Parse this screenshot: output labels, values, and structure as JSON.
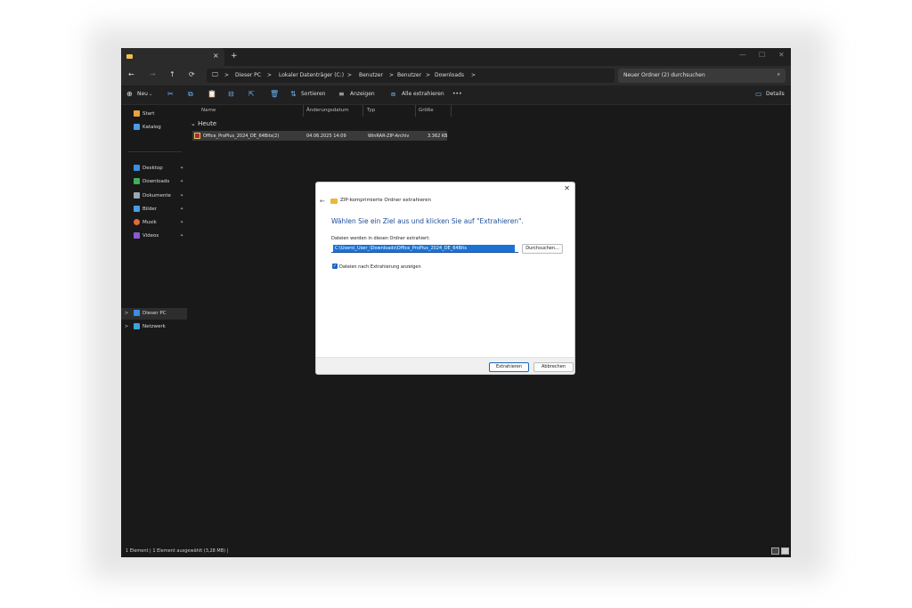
{
  "window": {
    "tab_close": "×",
    "tab_new": "+",
    "controls": {
      "minimize": "—",
      "maximize": "☐",
      "close": "✕"
    }
  },
  "nav": {
    "back": "←",
    "forward": "→",
    "up": "↑",
    "refresh": "⟳",
    "breadcrumb": [
      "Dieser PC",
      "Lokaler Datenträger (C:)",
      "Benutzer",
      "Benutzer",
      "Downloads"
    ],
    "separator": ">",
    "search_placeholder": "Neuer Ordner (2) durchsuchen"
  },
  "toolbar": {
    "new_label": "Neu",
    "sort_label": "Sortieren",
    "view_label": "Anzeigen",
    "extract_all_label": "Alle extrahieren",
    "more_label": "•••",
    "details_label": "Details"
  },
  "sidebar": {
    "top": [
      {
        "label": "Start",
        "icon": "home-icon",
        "color": "#e8a33d"
      },
      {
        "label": "Katalog",
        "icon": "gallery-icon",
        "color": "#4a9be8"
      }
    ],
    "quick": [
      {
        "label": "Desktop",
        "icon": "desktop-icon",
        "color": "#3b8ee0"
      },
      {
        "label": "Downloads",
        "icon": "downloads-icon",
        "color": "#3fae5a"
      },
      {
        "label": "Dokumente",
        "icon": "documents-icon",
        "color": "#9aa6b5"
      },
      {
        "label": "Bilder",
        "icon": "pictures-icon",
        "color": "#4a9be8"
      },
      {
        "label": "Musik",
        "icon": "music-icon",
        "color": "#e06a3c"
      },
      {
        "label": "Videos",
        "icon": "videos-icon",
        "color": "#8a5ad8"
      }
    ],
    "pin": "📌",
    "this_pc": "Dieser PC",
    "network": "Netzwerk"
  },
  "columns": {
    "name": "Name",
    "date": "Änderungsdatum",
    "type": "Typ",
    "size": "Größe"
  },
  "group_label": "Heute",
  "file": {
    "name": "Office_ProPlus_2024_DE_64Bits(2)",
    "date": "04.06.2025 14:09",
    "type": "WinRAR-ZIP-Archiv",
    "size": "3.362 KB"
  },
  "status": "1 Element  |  1 Element ausgewählt (3,28 MB)  |",
  "dialog": {
    "title": "ZIP-komprimierte Ordner extrahieren",
    "heading": "Wählen Sie ein Ziel aus und klicken Sie auf \"Extrahieren\".",
    "label": "Dateien werden in diesen Ordner extrahiert:",
    "path": "C:\\Users\\_User_\\Downloads\\Office_ProPlus_2024_DE_64Bits",
    "browse": "Durchsuchen...",
    "checkbox": "Dateien nach Extrahierung anzeigen",
    "checkbox_checked": true,
    "extract": "Extrahieren",
    "cancel": "Abbrechen",
    "close": "✕",
    "back": "←"
  }
}
